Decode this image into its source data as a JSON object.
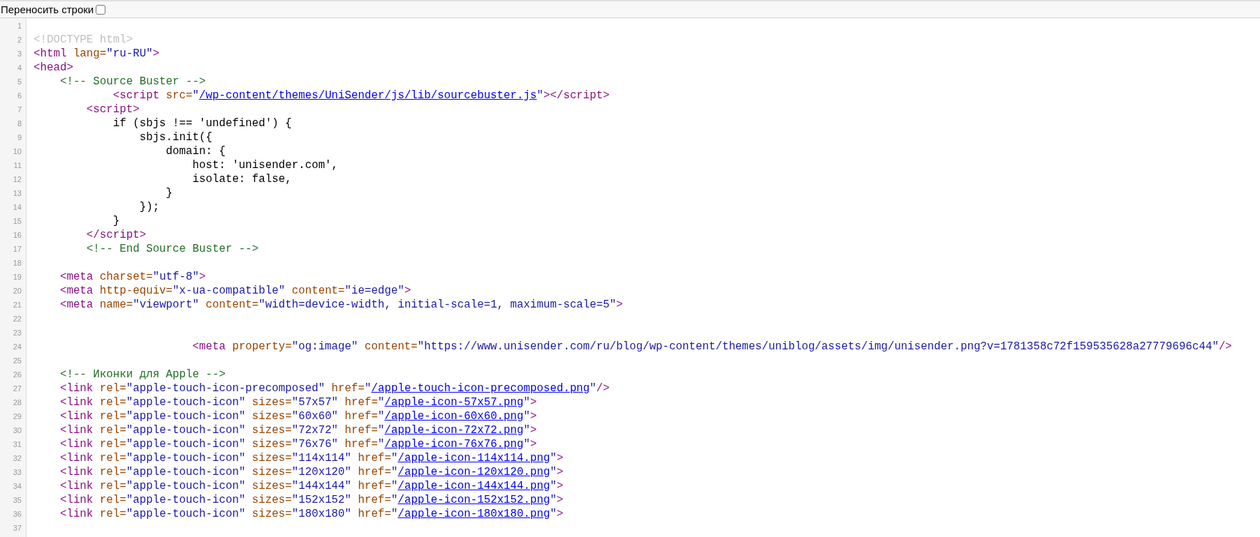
{
  "toolbar": {
    "wrap_label": "Переносить строки",
    "wrap_checked": false
  },
  "lines": [
    {
      "number": "1"
    },
    {
      "number": "2",
      "tokens": [
        {
          "kind": "doctype",
          "text": "<!DOCTYPE html>"
        }
      ]
    },
    {
      "number": "3",
      "tokens": [
        {
          "kind": "tag",
          "text": "<html"
        },
        {
          "kind": "attr",
          "text": " lang="
        },
        {
          "kind": "value",
          "text": "\"ru-RU\""
        },
        {
          "kind": "tag",
          "text": ">"
        }
      ]
    },
    {
      "number": "4",
      "tokens": [
        {
          "kind": "tag",
          "text": "<head>"
        }
      ]
    },
    {
      "number": "5",
      "tokens": [
        {
          "kind": "comment",
          "text": "    <!-- Source Buster -->"
        }
      ]
    },
    {
      "number": "6",
      "tokens": [
        {
          "kind": "tag",
          "text": "            <script"
        },
        {
          "kind": "attr",
          "text": " src="
        },
        {
          "kind": "value",
          "text": "\""
        },
        {
          "kind": "link",
          "text": "/wp-content/themes/UniSender/js/lib/sourcebuster.js"
        },
        {
          "kind": "value",
          "text": "\""
        },
        {
          "kind": "tag",
          "text": "></script>"
        }
      ]
    },
    {
      "number": "7",
      "tokens": [
        {
          "kind": "tag",
          "text": "        <script>"
        }
      ]
    },
    {
      "number": "8",
      "tokens": [
        {
          "kind": "text",
          "text": "            if (sbjs !== 'undefined') {"
        }
      ]
    },
    {
      "number": "9",
      "tokens": [
        {
          "kind": "text",
          "text": "                sbjs.init({"
        }
      ]
    },
    {
      "number": "10",
      "tokens": [
        {
          "kind": "text",
          "text": "                    domain: {"
        }
      ]
    },
    {
      "number": "11",
      "tokens": [
        {
          "kind": "text",
          "text": "                        host: 'unisender.com',"
        }
      ]
    },
    {
      "number": "12",
      "tokens": [
        {
          "kind": "text",
          "text": "                        isolate: false,"
        }
      ]
    },
    {
      "number": "13",
      "tokens": [
        {
          "kind": "text",
          "text": "                    }"
        }
      ]
    },
    {
      "number": "14",
      "tokens": [
        {
          "kind": "text",
          "text": "                });"
        }
      ]
    },
    {
      "number": "15",
      "tokens": [
        {
          "kind": "text",
          "text": "            }"
        }
      ]
    },
    {
      "number": "16",
      "tokens": [
        {
          "kind": "tag",
          "text": "        </script>"
        }
      ]
    },
    {
      "number": "17",
      "tokens": [
        {
          "kind": "comment",
          "text": "        <!-- End Source Buster -->"
        }
      ]
    },
    {
      "number": "18"
    },
    {
      "number": "19",
      "tokens": [
        {
          "kind": "tag",
          "text": "    <meta"
        },
        {
          "kind": "attr",
          "text": " charset="
        },
        {
          "kind": "value",
          "text": "\"utf-8\""
        },
        {
          "kind": "tag",
          "text": ">"
        }
      ]
    },
    {
      "number": "20",
      "tokens": [
        {
          "kind": "tag",
          "text": "    <meta"
        },
        {
          "kind": "attr",
          "text": " http-equiv="
        },
        {
          "kind": "value",
          "text": "\"x-ua-compatible\""
        },
        {
          "kind": "attr",
          "text": " content="
        },
        {
          "kind": "value",
          "text": "\"ie=edge\""
        },
        {
          "kind": "tag",
          "text": ">"
        }
      ]
    },
    {
      "number": "21",
      "tokens": [
        {
          "kind": "tag",
          "text": "    <meta"
        },
        {
          "kind": "attr",
          "text": " name="
        },
        {
          "kind": "value",
          "text": "\"viewport\""
        },
        {
          "kind": "attr",
          "text": " content="
        },
        {
          "kind": "value",
          "text": "\"width=device-width, initial-scale=1, maximum-scale=5\""
        },
        {
          "kind": "tag",
          "text": ">"
        }
      ]
    },
    {
      "number": "22"
    },
    {
      "number": "23"
    },
    {
      "number": "24",
      "tokens": [
        {
          "kind": "tag",
          "text": "                        <meta"
        },
        {
          "kind": "attr",
          "text": " property="
        },
        {
          "kind": "value",
          "text": "\"og:image\""
        },
        {
          "kind": "attr",
          "text": " content="
        },
        {
          "kind": "value",
          "text": "\"https://www.unisender.com/ru/blog/wp-content/themes/uniblog/assets/img/unisender.png?v=1781358c72f159535628a27779696c44\""
        },
        {
          "kind": "tag",
          "text": "/>"
        }
      ]
    },
    {
      "number": "25"
    },
    {
      "number": "26",
      "tokens": [
        {
          "kind": "comment",
          "text": "    <!-- Иконки для Apple -->"
        }
      ]
    },
    {
      "number": "27",
      "tokens": [
        {
          "kind": "tag",
          "text": "    <link"
        },
        {
          "kind": "attr",
          "text": " rel="
        },
        {
          "kind": "value",
          "text": "\"apple-touch-icon-precomposed\""
        },
        {
          "kind": "attr",
          "text": " href="
        },
        {
          "kind": "value",
          "text": "\""
        },
        {
          "kind": "link",
          "text": "/apple-touch-icon-precomposed.png"
        },
        {
          "kind": "value",
          "text": "\""
        },
        {
          "kind": "tag",
          "text": "/>"
        }
      ]
    },
    {
      "number": "28",
      "tokens": [
        {
          "kind": "tag",
          "text": "    <link"
        },
        {
          "kind": "attr",
          "text": " rel="
        },
        {
          "kind": "value",
          "text": "\"apple-touch-icon\""
        },
        {
          "kind": "attr",
          "text": " sizes="
        },
        {
          "kind": "value",
          "text": "\"57x57\""
        },
        {
          "kind": "attr",
          "text": " href="
        },
        {
          "kind": "value",
          "text": "\""
        },
        {
          "kind": "link",
          "text": "/apple-icon-57x57.png"
        },
        {
          "kind": "value",
          "text": "\""
        },
        {
          "kind": "tag",
          "text": ">"
        }
      ]
    },
    {
      "number": "29",
      "tokens": [
        {
          "kind": "tag",
          "text": "    <link"
        },
        {
          "kind": "attr",
          "text": " rel="
        },
        {
          "kind": "value",
          "text": "\"apple-touch-icon\""
        },
        {
          "kind": "attr",
          "text": " sizes="
        },
        {
          "kind": "value",
          "text": "\"60x60\""
        },
        {
          "kind": "attr",
          "text": " href="
        },
        {
          "kind": "value",
          "text": "\""
        },
        {
          "kind": "link",
          "text": "/apple-icon-60x60.png"
        },
        {
          "kind": "value",
          "text": "\""
        },
        {
          "kind": "tag",
          "text": ">"
        }
      ]
    },
    {
      "number": "30",
      "tokens": [
        {
          "kind": "tag",
          "text": "    <link"
        },
        {
          "kind": "attr",
          "text": " rel="
        },
        {
          "kind": "value",
          "text": "\"apple-touch-icon\""
        },
        {
          "kind": "attr",
          "text": " sizes="
        },
        {
          "kind": "value",
          "text": "\"72x72\""
        },
        {
          "kind": "attr",
          "text": " href="
        },
        {
          "kind": "value",
          "text": "\""
        },
        {
          "kind": "link",
          "text": "/apple-icon-72x72.png"
        },
        {
          "kind": "value",
          "text": "\""
        },
        {
          "kind": "tag",
          "text": ">"
        }
      ]
    },
    {
      "number": "31",
      "tokens": [
        {
          "kind": "tag",
          "text": "    <link"
        },
        {
          "kind": "attr",
          "text": " rel="
        },
        {
          "kind": "value",
          "text": "\"apple-touch-icon\""
        },
        {
          "kind": "attr",
          "text": " sizes="
        },
        {
          "kind": "value",
          "text": "\"76x76\""
        },
        {
          "kind": "attr",
          "text": " href="
        },
        {
          "kind": "value",
          "text": "\""
        },
        {
          "kind": "link",
          "text": "/apple-icon-76x76.png"
        },
        {
          "kind": "value",
          "text": "\""
        },
        {
          "kind": "tag",
          "text": ">"
        }
      ]
    },
    {
      "number": "32",
      "tokens": [
        {
          "kind": "tag",
          "text": "    <link"
        },
        {
          "kind": "attr",
          "text": " rel="
        },
        {
          "kind": "value",
          "text": "\"apple-touch-icon\""
        },
        {
          "kind": "attr",
          "text": " sizes="
        },
        {
          "kind": "value",
          "text": "\"114x114\""
        },
        {
          "kind": "attr",
          "text": " href="
        },
        {
          "kind": "value",
          "text": "\""
        },
        {
          "kind": "link",
          "text": "/apple-icon-114x114.png"
        },
        {
          "kind": "value",
          "text": "\""
        },
        {
          "kind": "tag",
          "text": ">"
        }
      ]
    },
    {
      "number": "33",
      "tokens": [
        {
          "kind": "tag",
          "text": "    <link"
        },
        {
          "kind": "attr",
          "text": " rel="
        },
        {
          "kind": "value",
          "text": "\"apple-touch-icon\""
        },
        {
          "kind": "attr",
          "text": " sizes="
        },
        {
          "kind": "value",
          "text": "\"120x120\""
        },
        {
          "kind": "attr",
          "text": " href="
        },
        {
          "kind": "value",
          "text": "\""
        },
        {
          "kind": "link",
          "text": "/apple-icon-120x120.png"
        },
        {
          "kind": "value",
          "text": "\""
        },
        {
          "kind": "tag",
          "text": ">"
        }
      ]
    },
    {
      "number": "34",
      "tokens": [
        {
          "kind": "tag",
          "text": "    <link"
        },
        {
          "kind": "attr",
          "text": " rel="
        },
        {
          "kind": "value",
          "text": "\"apple-touch-icon\""
        },
        {
          "kind": "attr",
          "text": " sizes="
        },
        {
          "kind": "value",
          "text": "\"144x144\""
        },
        {
          "kind": "attr",
          "text": " href="
        },
        {
          "kind": "value",
          "text": "\""
        },
        {
          "kind": "link",
          "text": "/apple-icon-144x144.png"
        },
        {
          "kind": "value",
          "text": "\""
        },
        {
          "kind": "tag",
          "text": ">"
        }
      ]
    },
    {
      "number": "35",
      "tokens": [
        {
          "kind": "tag",
          "text": "    <link"
        },
        {
          "kind": "attr",
          "text": " rel="
        },
        {
          "kind": "value",
          "text": "\"apple-touch-icon\""
        },
        {
          "kind": "attr",
          "text": " sizes="
        },
        {
          "kind": "value",
          "text": "\"152x152\""
        },
        {
          "kind": "attr",
          "text": " href="
        },
        {
          "kind": "value",
          "text": "\""
        },
        {
          "kind": "link",
          "text": "/apple-icon-152x152.png"
        },
        {
          "kind": "value",
          "text": "\""
        },
        {
          "kind": "tag",
          "text": ">"
        }
      ]
    },
    {
      "number": "36",
      "tokens": [
        {
          "kind": "tag",
          "text": "    <link"
        },
        {
          "kind": "attr",
          "text": " rel="
        },
        {
          "kind": "value",
          "text": "\"apple-touch-icon\""
        },
        {
          "kind": "attr",
          "text": " sizes="
        },
        {
          "kind": "value",
          "text": "\"180x180\""
        },
        {
          "kind": "attr",
          "text": " href="
        },
        {
          "kind": "value",
          "text": "\""
        },
        {
          "kind": "link",
          "text": "/apple-icon-180x180.png"
        },
        {
          "kind": "value",
          "text": "\""
        },
        {
          "kind": "tag",
          "text": ">"
        }
      ]
    },
    {
      "number": "37"
    }
  ]
}
